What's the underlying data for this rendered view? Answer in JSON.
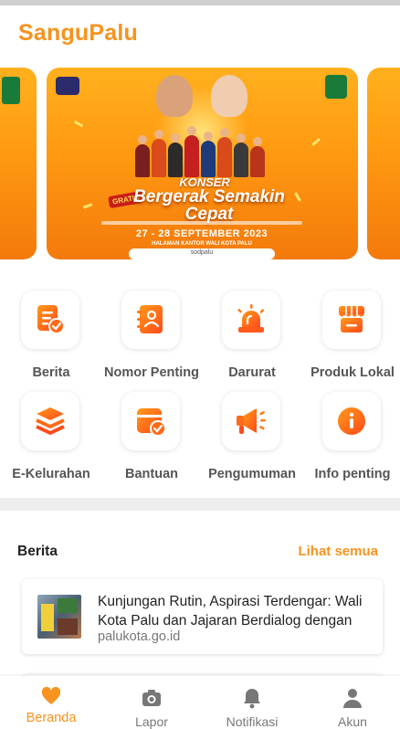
{
  "app": {
    "title": "SanguPalu"
  },
  "banner": {
    "konser_text": "KONSER",
    "headline": "Bergerak Semakin Cepat",
    "badge": "GRATIS",
    "date": "27 - 28 SEPTEMBER 2023",
    "venue": "HALAMAN KANTOR WALI KOTA PALU",
    "sponsor": "sodpalu",
    "active_slide": 2,
    "slide_count": 3
  },
  "menu": {
    "items": [
      {
        "label": "Berita",
        "icon": "document-check-icon"
      },
      {
        "label": "Nomor Penting",
        "icon": "contact-book-icon"
      },
      {
        "label": "Darurat",
        "icon": "siren-icon"
      },
      {
        "label": "Produk Lokal",
        "icon": "shop-icon"
      },
      {
        "label": "E-Kelurahan",
        "icon": "layers-icon"
      },
      {
        "label": "Bantuan",
        "icon": "calendar-check-icon"
      },
      {
        "label": "Pengumuman",
        "icon": "megaphone-icon"
      },
      {
        "label": "Info penting",
        "icon": "info-icon"
      }
    ]
  },
  "news": {
    "heading": "Berita",
    "see_all": "Lihat semua",
    "items": [
      {
        "title": "Kunjungan Rutin, Aspirasi Terdengar: Wali Kota Palu dan Jajaran Berdialog dengan",
        "source": "palukota.go.id"
      }
    ]
  },
  "bottom_nav": {
    "items": [
      {
        "label": "Beranda",
        "icon": "heart-icon",
        "active": true
      },
      {
        "label": "Lapor",
        "icon": "camera-icon",
        "active": false
      },
      {
        "label": "Notifikasi",
        "icon": "bell-icon",
        "active": false
      },
      {
        "label": "Akun",
        "icon": "person-icon",
        "active": false
      }
    ]
  },
  "colors": {
    "accent": "#f7931e",
    "icon_gradient_start": "#ff9a1a",
    "icon_gradient_end": "#ff4a1a",
    "inactive": "#777777"
  }
}
